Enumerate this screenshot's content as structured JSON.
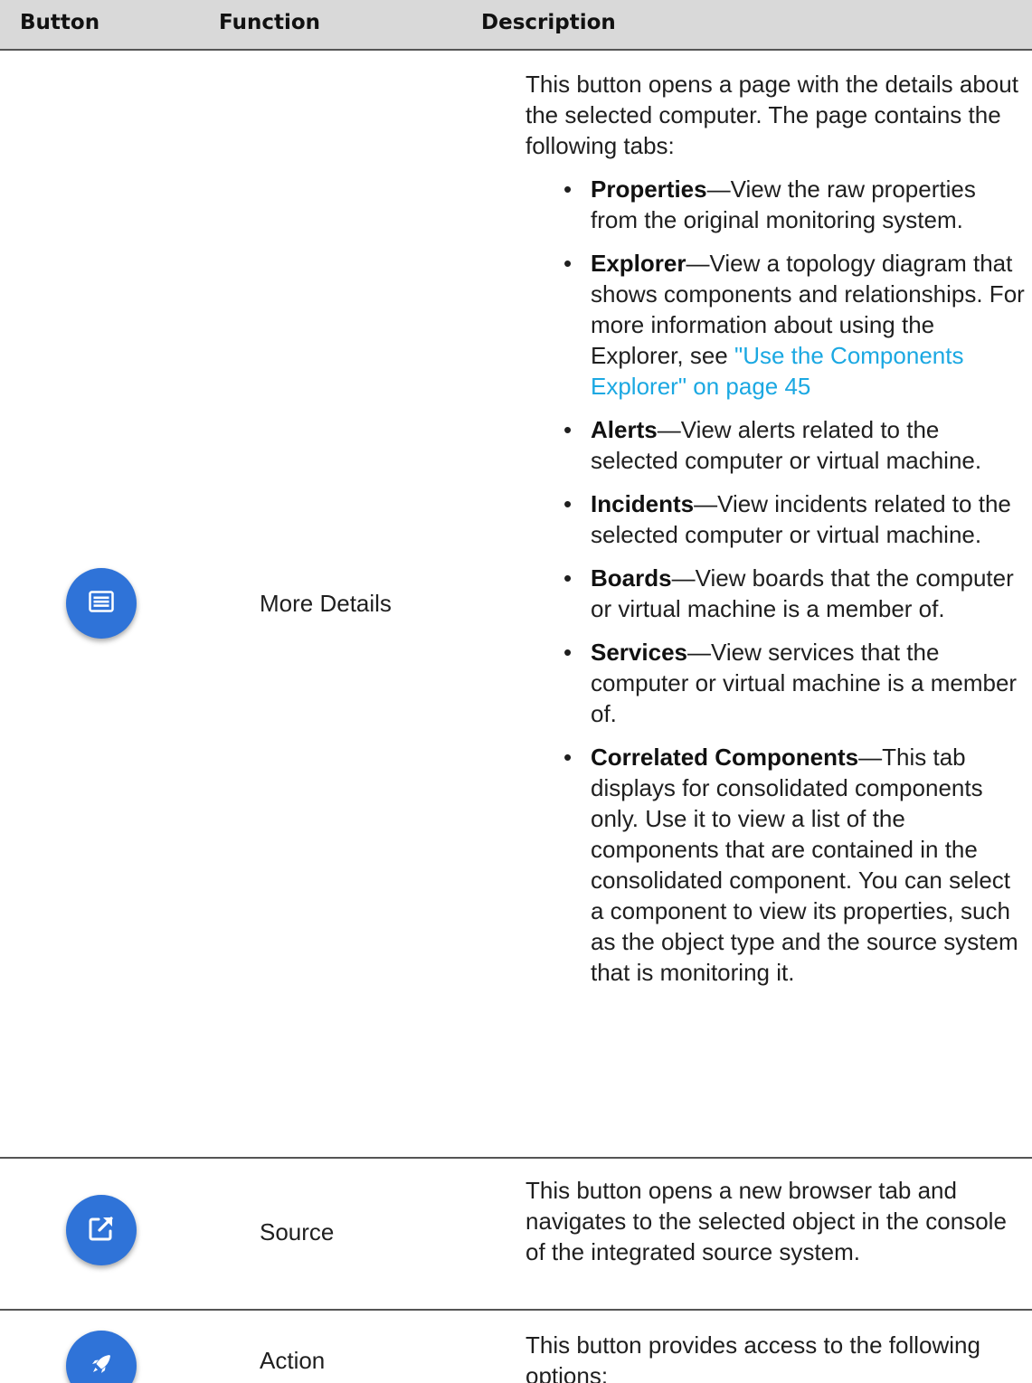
{
  "header": {
    "col_button": "Button",
    "col_function": "Function",
    "col_description": "Description"
  },
  "accent_color": "#2f73d8",
  "link_color": "#1ba8e2",
  "rows": [
    {
      "icon": "details-list-icon",
      "function": "More Details",
      "intro": "This button opens a page with the details about the selected computer. The page contains the following tabs:",
      "tabs": [
        {
          "name": "Properties",
          "sep": "—",
          "text": "View the raw properties from the original monitoring system."
        },
        {
          "name": "Explorer",
          "sep": "—",
          "text": "View a topology diagram that shows components and relationships. For more information about using the Explorer, see ",
          "link": "\"Use the Components Explorer\" on page 45"
        },
        {
          "name": "Alerts",
          "sep": "—",
          "text": "View alerts related to the selected computer or virtual machine."
        },
        {
          "name": "Incidents",
          "sep": "—",
          "text": "View incidents related to the selected computer or virtual machine."
        },
        {
          "name": "Boards",
          "sep": "—",
          "text": "View boards that the computer or virtual machine is a member of."
        },
        {
          "name": "Services",
          "sep": "—",
          "text": "View services that the computer or virtual machine is a member of."
        },
        {
          "name": "Correlated Components",
          "sep": "—",
          "text": "This tab displays for consolidated components only. Use it to view a list of the components that are contained in the consolidated component. You can select a component to view its properties, such as the object type and the source system that is monitoring it."
        }
      ]
    },
    {
      "icon": "external-link-icon",
      "function": "Source",
      "intro": "This button opens a new browser tab and navigates to the selected object in the console of the integrated source system."
    },
    {
      "icon": "rocket-icon",
      "function": "Action",
      "intro": "This button provides access to the following options:"
    }
  ]
}
